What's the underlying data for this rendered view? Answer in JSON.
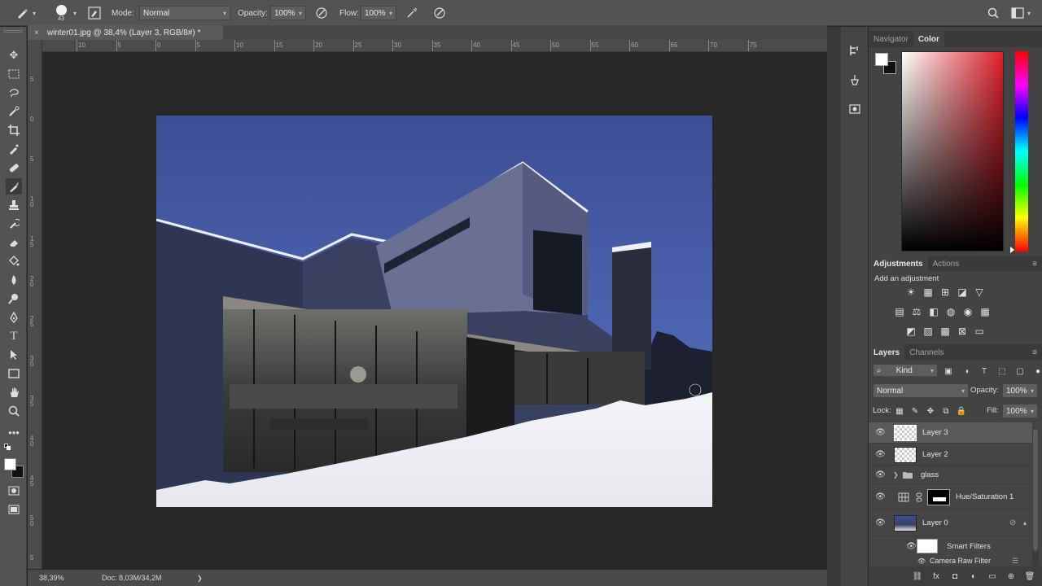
{
  "options_bar": {
    "brush_size": "43",
    "mode_label": "Mode:",
    "mode_value": "Normal",
    "opacity_label": "Opacity:",
    "opacity_value": "100%",
    "flow_label": "Flow:",
    "flow_value": "100%"
  },
  "document": {
    "tab_title": "winter01.jpg @ 38,4% (Layer 3, RGB/8#) *",
    "close_glyph": "×",
    "zoom": "38,39%",
    "doc_info": "Doc: 8,03M/34,2M",
    "status_arrow": "❯"
  },
  "ruler": {
    "h_ticks": [
      "10",
      "5",
      "0",
      "5",
      "10",
      "15",
      "20",
      "25",
      "30",
      "35",
      "40",
      "45",
      "50",
      "55",
      "60",
      "65",
      "70",
      "75"
    ],
    "v_ticks": [
      "5",
      "0",
      "5",
      "1 0",
      "1 5",
      "2 0",
      "2 5",
      "3 0",
      "3 5",
      "4 0",
      "4 5",
      "5 0",
      "5"
    ]
  },
  "color_panel": {
    "tab_navigator": "Navigator",
    "tab_color": "Color",
    "hue_color": "#e01f2a"
  },
  "adjustments_panel": {
    "tab_adjustments": "Adjustments",
    "tab_actions": "Actions",
    "add_label": "Add an adjustment"
  },
  "layers_panel": {
    "tab_layers": "Layers",
    "tab_channels": "Channels",
    "filter_kind": "Kind",
    "blend_mode": "Normal",
    "opacity_label": "Opacity:",
    "opacity_value": "100%",
    "lock_label": "Lock:",
    "fill_label": "Fill:",
    "fill_value": "100%",
    "layers": [
      {
        "name": "Layer 3"
      },
      {
        "name": "Layer 2"
      },
      {
        "name": "glass"
      },
      {
        "name": "Hue/Saturation 1"
      },
      {
        "name": "Layer 0"
      },
      {
        "name": "Smart Filters"
      },
      {
        "name": "Camera Raw Filter"
      }
    ],
    "bottom_icons": [
      "link-icon",
      "fx-icon",
      "mask-icon",
      "adjustment-icon",
      "folder-icon",
      "new-layer-icon",
      "trash-icon"
    ]
  }
}
